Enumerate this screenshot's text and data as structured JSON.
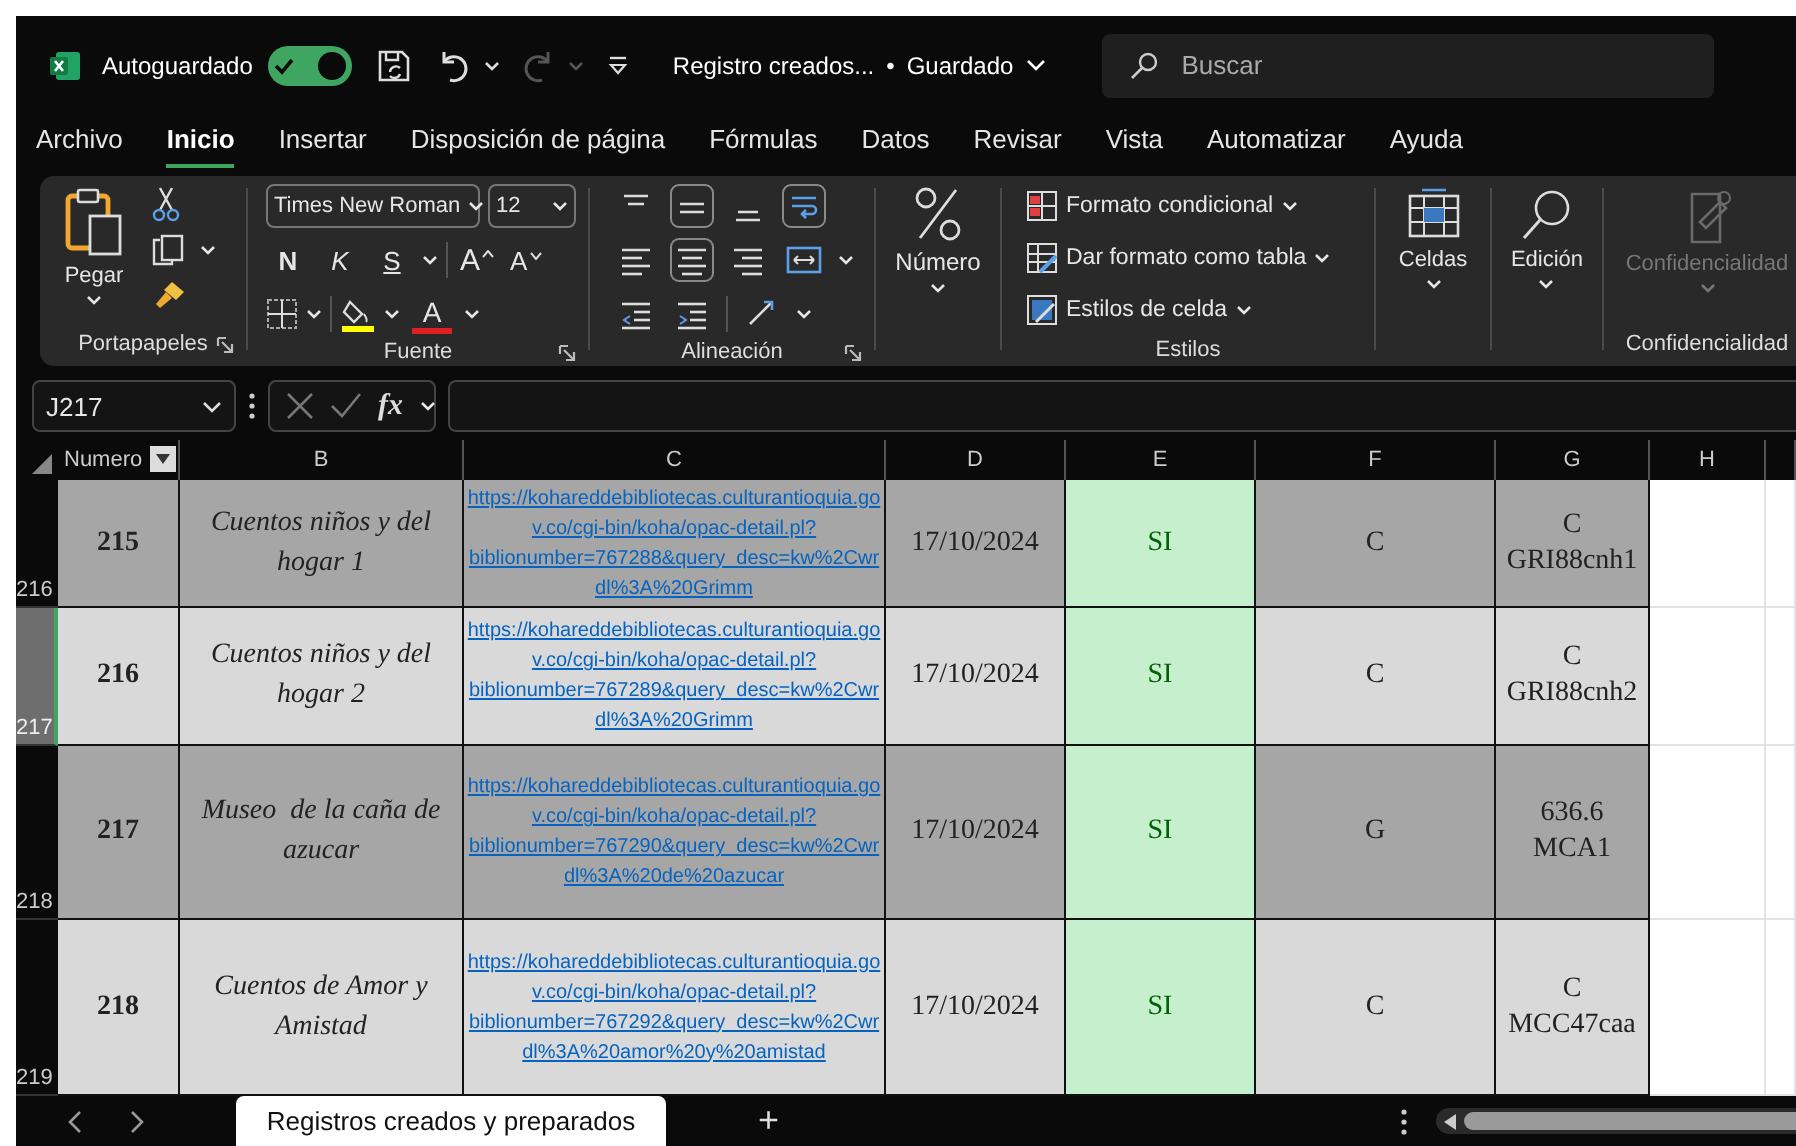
{
  "title_bar": {
    "autosave_label": "Autoguardado",
    "autosave_on": true,
    "document_title": "Registro creados...",
    "separator": "•",
    "save_status": "Guardado",
    "search_placeholder": "Buscar"
  },
  "menu_tabs": [
    {
      "label": "Archivo",
      "selected": false
    },
    {
      "label": "Inicio",
      "selected": true
    },
    {
      "label": "Insertar",
      "selected": false
    },
    {
      "label": "Disposición de página",
      "selected": false
    },
    {
      "label": "Fórmulas",
      "selected": false
    },
    {
      "label": "Datos",
      "selected": false
    },
    {
      "label": "Revisar",
      "selected": false
    },
    {
      "label": "Vista",
      "selected": false
    },
    {
      "label": "Automatizar",
      "selected": false
    },
    {
      "label": "Ayuda",
      "selected": false
    }
  ],
  "ribbon": {
    "clipboard": {
      "paste_label": "Pegar",
      "group_label": "Portapapeles"
    },
    "font": {
      "font_name": "Times New Roman",
      "font_size": "12",
      "bold": "N",
      "italic": "K",
      "underline": "S",
      "grow_font": "A",
      "shrink_font": "A",
      "font_color": "A",
      "group_label": "Fuente"
    },
    "alignment": {
      "group_label": "Alineación"
    },
    "number": {
      "label": "Número"
    },
    "styles": {
      "items": [
        "Formato condicional",
        "Dar formato como tabla",
        "Estilos de celda"
      ],
      "group_label": "Estilos"
    },
    "cells": {
      "label": "Celdas"
    },
    "editing": {
      "label": "Edición"
    },
    "sensitivity": {
      "label": "Confidencialidad",
      "disabled": true,
      "group_label": "Confidencialidad"
    }
  },
  "formula_bar": {
    "name_box": "J217",
    "function_label": "fx"
  },
  "sheet": {
    "columns": [
      {
        "label": "Numero",
        "filter": true
      },
      {
        "label": "B",
        "filter": false
      },
      {
        "label": "C",
        "filter": false
      },
      {
        "label": "D",
        "filter": false
      },
      {
        "label": "E",
        "filter": false
      },
      {
        "label": "F",
        "filter": false
      },
      {
        "label": "G",
        "filter": false
      },
      {
        "label": "H",
        "filter": false
      }
    ],
    "rows": [
      {
        "row_number": "216",
        "selected": false,
        "numero": "215",
        "title": "Cuentos niños y del hogar 1",
        "link": "https://kohareddebibliotecas.culturantioquia.gov.co/cgi-bin/koha/opac-detail.pl?biblionumber=767288&query_desc=kw%2Cwrdl%3A%20Grimm",
        "date": "17/10/2024",
        "status": "SI",
        "type": "C",
        "call_number": "C\nGRI88cnh1"
      },
      {
        "row_number": "217",
        "selected": true,
        "numero": "216",
        "title": "Cuentos niños y del hogar 2",
        "link": "https://kohareddebibliotecas.culturantioquia.gov.co/cgi-bin/koha/opac-detail.pl?biblionumber=767289&query_desc=kw%2Cwrdl%3A%20Grimm",
        "date": "17/10/2024",
        "status": "SI",
        "type": "C",
        "call_number": "C\nGRI88cnh2"
      },
      {
        "row_number": "218",
        "selected": false,
        "numero": "217",
        "title": "Museo  de la caña de azucar",
        "link": "https://kohareddebibliotecas.culturantioquia.gov.co/cgi-bin/koha/opac-detail.pl?biblionumber=767290&query_desc=kw%2Cwrdl%3A%20de%20azucar",
        "date": "17/10/2024",
        "status": "SI",
        "type": "G",
        "call_number": "636.6\nMCA1"
      },
      {
        "row_number": "219",
        "selected": false,
        "numero": "218",
        "title": "Cuentos de Amor y Amistad",
        "link": "https://kohareddebibliotecas.culturantioquia.gov.co/cgi-bin/koha/opac-detail.pl?biblionumber=767292&query_desc=kw%2Cwrdl%3A%20amor%20y%20amistad",
        "date": "17/10/2024",
        "status": "SI",
        "type": "C",
        "call_number": "C\nMCC47caa"
      }
    ]
  },
  "sheet_tabs": [
    {
      "label": "Registros creados y preparados",
      "selected": true
    }
  ],
  "add_sheet": "+"
}
